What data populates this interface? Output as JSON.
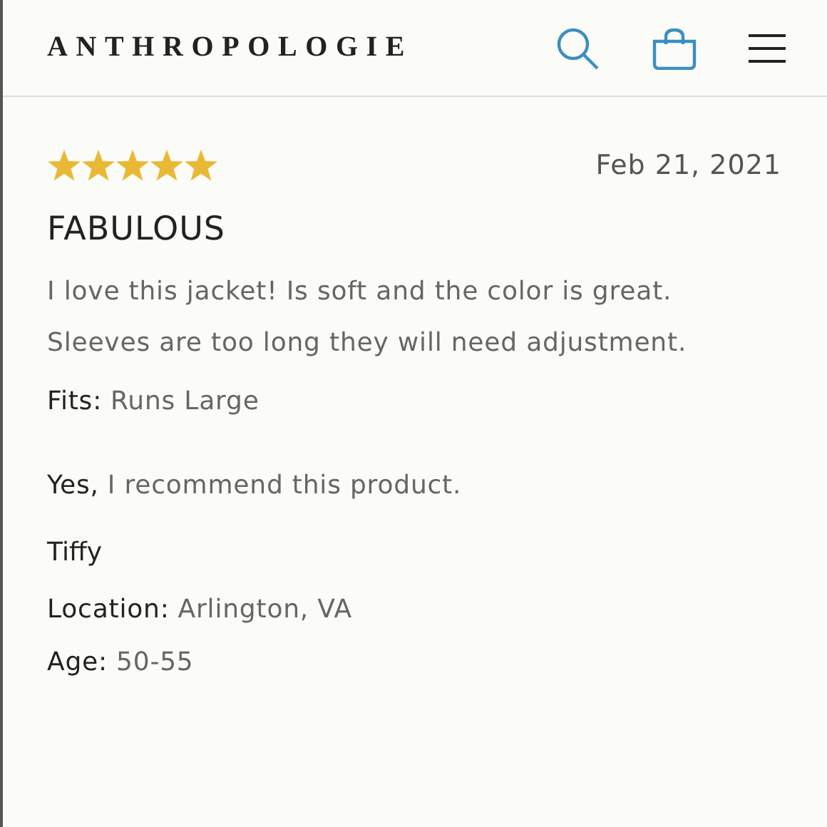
{
  "header": {
    "logo": "ANTHROPOLOGIE"
  },
  "review": {
    "stars": 5,
    "date": "Feb 21, 2021",
    "title": "FABULOUS",
    "body": [
      "I love this jacket! Is soft and the color is great.",
      "Sleeves are too long they will need adjustment."
    ],
    "fits": {
      "label": "Fits:",
      "value": "Runs Large"
    },
    "recommend": {
      "label": "Yes,",
      "value": "I recommend this product."
    },
    "author": "Tiffy",
    "location": {
      "label": "Location:",
      "value": "Arlington, VA"
    },
    "age": {
      "label": "Age:",
      "value": "50-55"
    }
  }
}
